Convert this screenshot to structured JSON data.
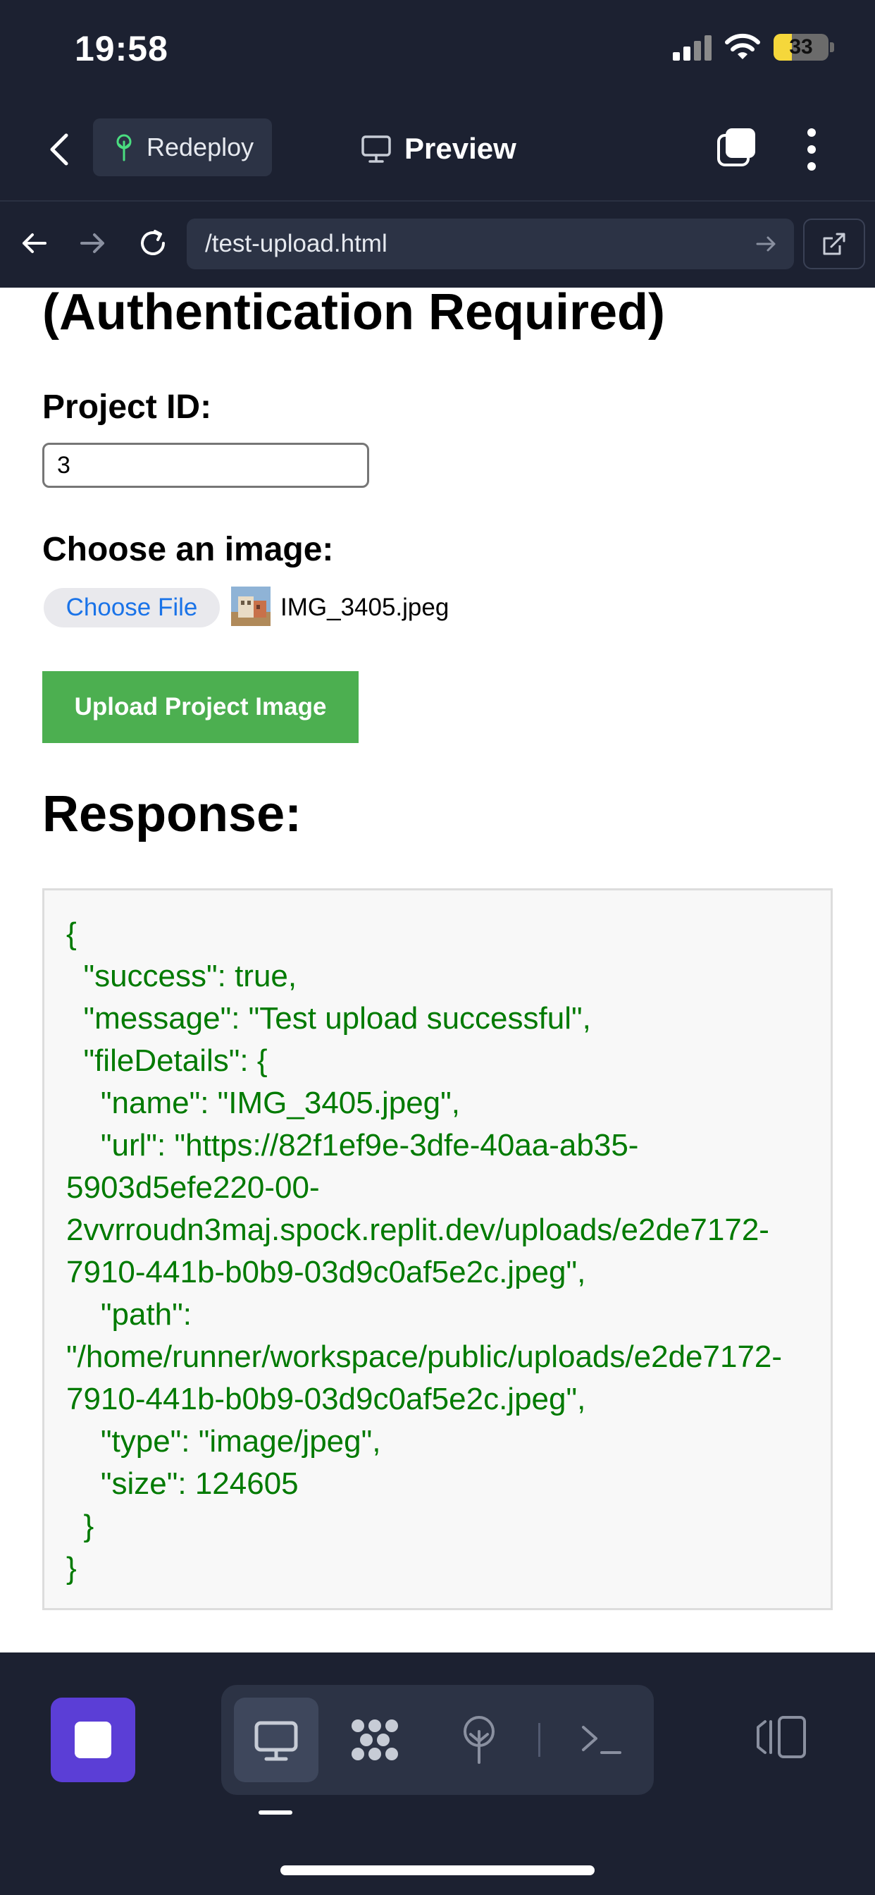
{
  "status_bar": {
    "time": "19:58",
    "battery": "33",
    "battery_level": 0.33
  },
  "app_header": {
    "redeploy_label": "Redeploy",
    "preview_label": "Preview"
  },
  "browser": {
    "url": "/test-upload.html"
  },
  "page": {
    "heading": "(Authentication Required)",
    "project_id_label": "Project ID:",
    "project_id_value": "3",
    "choose_image_label": "Choose an image:",
    "choose_file_button": "Choose File",
    "file_name": "IMG_3405.jpeg",
    "upload_button": "Upload Project Image",
    "response_heading": "Response:",
    "response_text": "{\n  \"success\": true,\n  \"message\": \"Test upload successful\",\n  \"fileDetails\": {\n    \"name\": \"IMG_3405.jpeg\",\n    \"url\": \"https://82f1ef9e-3dfe-40aa-ab35-\n5903d5efe220-00-\n2vvrroudn3maj.spock.replit.dev/uploads/e2de7172-\n7910-441b-b0b9-03d9c0af5e2c.jpeg\",\n    \"path\":\n\"/home/runner/workspace/public/uploads/e2de7172-\n7910-441b-b0b9-03d9c0af5e2c.jpeg\",\n    \"type\": \"image/jpeg\",\n    \"size\": 124605\n  }\n}"
  },
  "bottom_toolbar": {
    "icons": [
      "stop-icon",
      "desktop-icon",
      "workflows-icon",
      "deployments-icon",
      "terminal-icon",
      "sidebar-icon"
    ]
  },
  "colors": {
    "chrome": "#1c2131",
    "chrome_field": "#2c3345",
    "upload_button": "#4caf50",
    "response_text": "#007a00",
    "link_blue": "#1a73e8",
    "stop_button": "#5b3ed6"
  }
}
